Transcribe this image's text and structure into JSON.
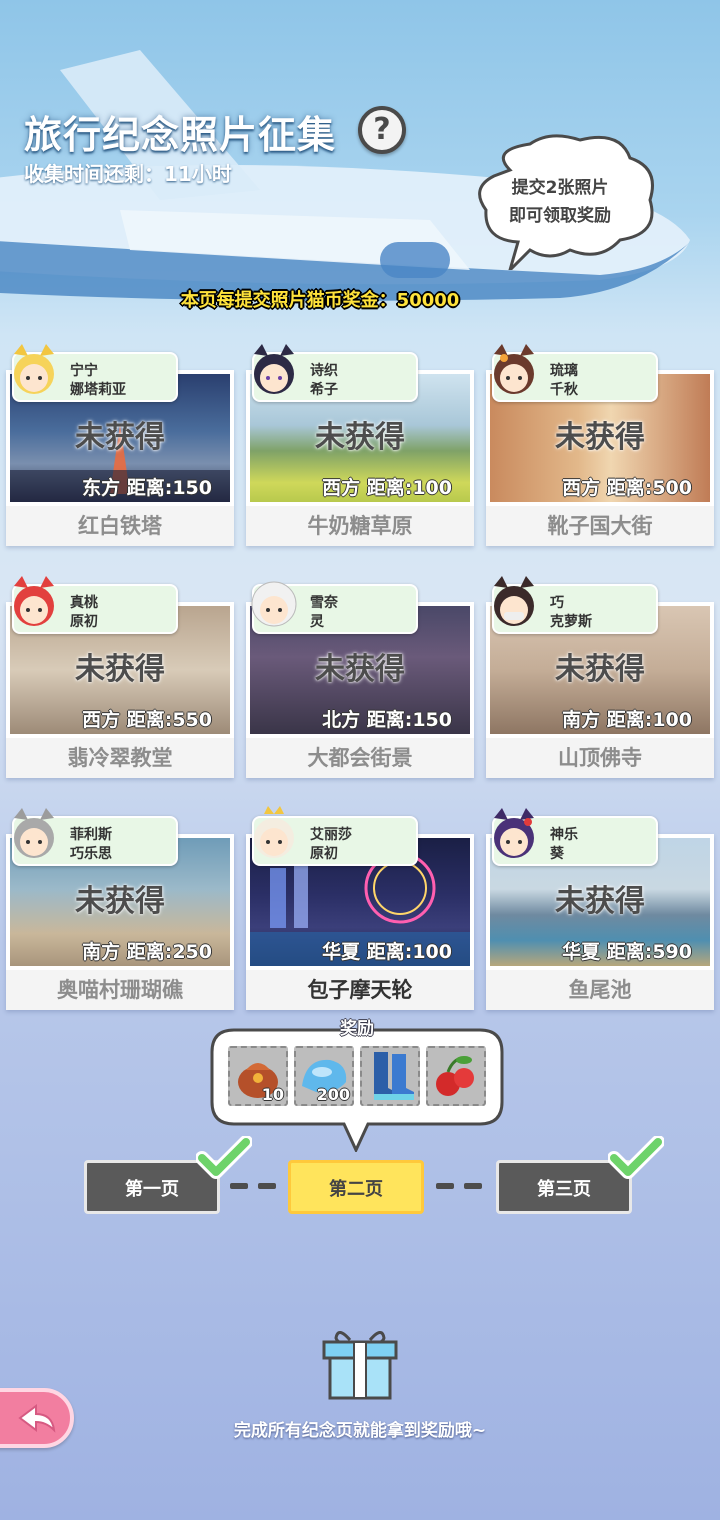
{
  "header": {
    "title": "旅行纪念照片征集",
    "help_icon": "?",
    "timer": "收集时间还剩：11小时"
  },
  "hint": {
    "line1": "提交2张照片",
    "line2": "即可领取奖励"
  },
  "bonus_text": "本页每提交照片猫币奖金：50000",
  "cards": [
    {
      "name1": "宁宁",
      "name2": "娜塔莉亚",
      "status": "未获得",
      "distance": "东方  距离:150",
      "place": "红白铁塔"
    },
    {
      "name1": "诗织",
      "name2": "希子",
      "status": "未获得",
      "distance": "西方  距离:100",
      "place": "牛奶糖草原"
    },
    {
      "name1": "琉璃",
      "name2": "千秋",
      "status": "未获得",
      "distance": "西方  距离:500",
      "place": "靴子国大街"
    },
    {
      "name1": "真桃",
      "name2": "原初",
      "status": "未获得",
      "distance": "西方  距离:550",
      "place": "翡冷翠教堂"
    },
    {
      "name1": "雪奈",
      "name2": "灵",
      "status": "未获得",
      "distance": "北方  距离:150",
      "place": "大都会街景"
    },
    {
      "name1": "巧",
      "name2": "克萝斯",
      "status": "未获得",
      "distance": "南方  距离:100",
      "place": "山顶佛寺"
    },
    {
      "name1": "菲利斯",
      "name2": "巧乐思",
      "status": "未获得",
      "distance": "南方  距离:250",
      "place": "奥喵村珊瑚礁"
    },
    {
      "name1": "艾丽莎",
      "name2": "原初",
      "status": "",
      "distance": "华夏  距离:100",
      "place": "包子摩天轮"
    },
    {
      "name1": "神乐",
      "name2": "葵",
      "status": "未获得",
      "distance": "华夏  距离:590",
      "place": "鱼尾池"
    }
  ],
  "rewards": {
    "label": "奖励",
    "items": [
      {
        "icon": "treasure-bag-icon",
        "count": "10"
      },
      {
        "icon": "blue-slime-icon",
        "count": "200"
      },
      {
        "icon": "boots-icon",
        "count": ""
      },
      {
        "icon": "cherries-icon",
        "count": ""
      }
    ]
  },
  "pages": {
    "p1": "第一页",
    "p2": "第二页",
    "p3": "第三页"
  },
  "footer": "完成所有纪念页就能拿到奖励哦~",
  "colors": {
    "accent": "#ffe45c",
    "tag_bg": "#e8f7e6",
    "back_button": "#f27ea0",
    "check": "#6ed36a"
  }
}
